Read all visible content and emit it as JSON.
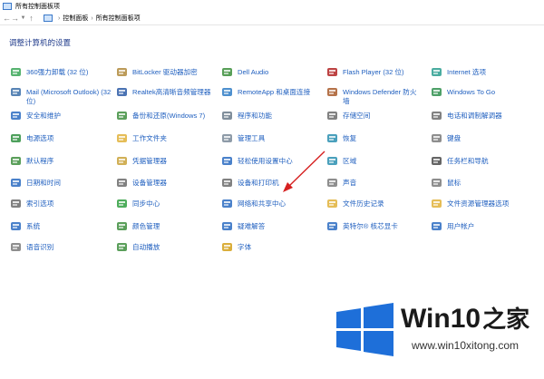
{
  "window": {
    "title": "所有控制面板项"
  },
  "address_bar": {
    "crumbs": [
      "控制面板",
      "所有控制面板项"
    ]
  },
  "page": {
    "heading": "调整计算机的设置"
  },
  "items": [
    {
      "label": "360强力卸载 (32 位)",
      "icon": "uninstall-icon",
      "color": "#3aa657"
    },
    {
      "label": "BitLocker 驱动器加密",
      "icon": "bitlocker-icon",
      "color": "#b08a3c"
    },
    {
      "label": "Dell Audio",
      "icon": "audio-icon",
      "color": "#3b8e3b"
    },
    {
      "label": "Flash Player (32 位)",
      "icon": "flash-icon",
      "color": "#b22222"
    },
    {
      "label": "Internet 选项",
      "icon": "internet-icon",
      "color": "#2a9d8f"
    },
    {
      "label": "Mail (Microsoft Outlook) (32 位)",
      "icon": "mail-icon",
      "color": "#3b6ea8"
    },
    {
      "label": "Realtek高清晰音频管理器",
      "icon": "realtek-icon",
      "color": "#2b5aa6"
    },
    {
      "label": "RemoteApp 和桌面连接",
      "icon": "remoteapp-icon",
      "color": "#2f7cc6"
    },
    {
      "label": "Windows Defender 防火墙",
      "icon": "firewall-icon",
      "color": "#a85a2a"
    },
    {
      "label": "Windows To Go",
      "icon": "windows-to-go-icon",
      "color": "#2f8f4e"
    },
    {
      "label": "安全和维护",
      "icon": "security-flag-icon",
      "color": "#2a6bc1"
    },
    {
      "label": "备份和还原(Windows 7)",
      "icon": "backup-icon",
      "color": "#3e8e3e"
    },
    {
      "label": "程序和功能",
      "icon": "programs-icon",
      "color": "#6a7a8a"
    },
    {
      "label": "存储空间",
      "icon": "storage-icon",
      "color": "#6b6b6b"
    },
    {
      "label": "电话和调制解调器",
      "icon": "phone-icon",
      "color": "#6b6b6b"
    },
    {
      "label": "电源选项",
      "icon": "power-icon",
      "color": "#2f8f3f"
    },
    {
      "label": "工作文件夹",
      "icon": "folder-icon",
      "color": "#e0b13a"
    },
    {
      "label": "管理工具",
      "icon": "admin-tools-icon",
      "color": "#7a8a99"
    },
    {
      "label": "恢复",
      "icon": "recovery-icon",
      "color": "#2a8fb0"
    },
    {
      "label": "键盘",
      "icon": "keyboard-icon",
      "color": "#7a7a7a"
    },
    {
      "label": "默认程序",
      "icon": "default-programs-icon",
      "color": "#3e8e3e"
    },
    {
      "label": "凭据管理器",
      "icon": "credential-icon",
      "color": "#c9a23a"
    },
    {
      "label": "轻松使用设置中心",
      "icon": "ease-of-access-icon",
      "color": "#2a6bc1"
    },
    {
      "label": "区域",
      "icon": "region-icon",
      "color": "#2a8fb0"
    },
    {
      "label": "任务栏和导航",
      "icon": "taskbar-icon",
      "color": "#4a4a4a"
    },
    {
      "label": "日期和时间",
      "icon": "clock-icon",
      "color": "#2a6bc1"
    },
    {
      "label": "设备管理器",
      "icon": "device-manager-icon",
      "color": "#6b6b6b"
    },
    {
      "label": "设备和打印机",
      "icon": "printer-icon",
      "color": "#6b6b6b"
    },
    {
      "label": "声音",
      "icon": "speaker-icon",
      "color": "#7a7a7a"
    },
    {
      "label": "鼠标",
      "icon": "mouse-icon",
      "color": "#7a7a7a"
    },
    {
      "label": "索引选项",
      "icon": "index-icon",
      "color": "#6b6b6b"
    },
    {
      "label": "同步中心",
      "icon": "sync-icon",
      "color": "#2f9f3f"
    },
    {
      "label": "网络和共享中心",
      "icon": "network-icon",
      "color": "#2a6bc1"
    },
    {
      "label": "文件历史记录",
      "icon": "file-history-icon",
      "color": "#e0b13a"
    },
    {
      "label": "文件资源管理器选项",
      "icon": "explorer-options-icon",
      "color": "#e0b13a"
    },
    {
      "label": "系统",
      "icon": "system-icon",
      "color": "#2a6bc1"
    },
    {
      "label": "颜色管理",
      "icon": "color-management-icon",
      "color": "#3e8e3e"
    },
    {
      "label": "疑难解答",
      "icon": "troubleshoot-icon",
      "color": "#2a6bc1"
    },
    {
      "label": "英特尔® 核芯显卡",
      "icon": "intel-graphics-icon",
      "color": "#2a6bc1"
    },
    {
      "label": "用户帐户",
      "icon": "user-accounts-icon",
      "color": "#2a6bc1"
    },
    {
      "label": "语音识别",
      "icon": "microphone-icon",
      "color": "#7a7a7a"
    },
    {
      "label": "自动播放",
      "icon": "autoplay-icon",
      "color": "#3e8e3e"
    },
    {
      "label": "字体",
      "icon": "fonts-icon",
      "color": "#d4a01a"
    }
  ],
  "watermark": {
    "brand": "Win10",
    "brand_suffix": "之家",
    "url": "www.win10xitong.com",
    "colors": {
      "windows_blue": "#1e6fd9",
      "brand_text": "#1a1a1a",
      "accent_red": "#d8262c"
    }
  }
}
